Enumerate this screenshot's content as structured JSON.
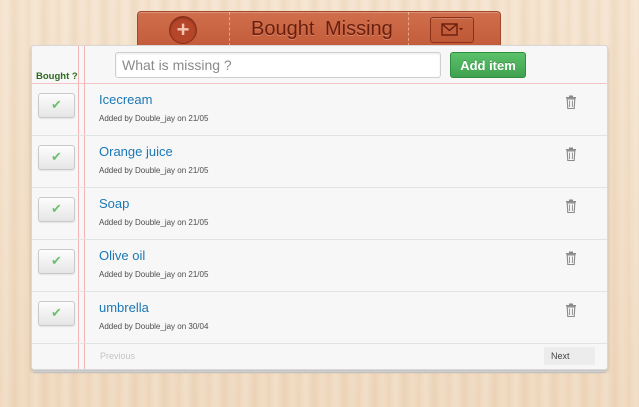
{
  "header": {
    "add_icon_glyph": "+",
    "tabs": [
      {
        "label": "Bought"
      },
      {
        "label": "Missing"
      }
    ],
    "mail_icon": "envelope-dropdown-icon"
  },
  "list": {
    "bought_column_label": "Bought ?",
    "search": {
      "placeholder": "What is missing ?",
      "value": ""
    },
    "add_item_label": "Add item",
    "check_glyph": "✔",
    "items": [
      {
        "name": "Icecream",
        "meta": "Added by Double_jay on 21/05"
      },
      {
        "name": "Orange juice",
        "meta": "Added by Double_jay on 21/05"
      },
      {
        "name": "Soap",
        "meta": "Added by Double_jay on 21/05"
      },
      {
        "name": "Olive oil",
        "meta": "Added by Double_jay on 21/05"
      },
      {
        "name": "umbrella",
        "meta": "Added by Double_jay on 30/04"
      }
    ],
    "pagination": {
      "previous_label": "Previous",
      "next_label": "Next"
    }
  },
  "colors": {
    "accent_green": "#3fa14f",
    "leather": "#c35c3b",
    "link_blue": "#1b78b5",
    "margin_red": "#f2b4b4"
  }
}
